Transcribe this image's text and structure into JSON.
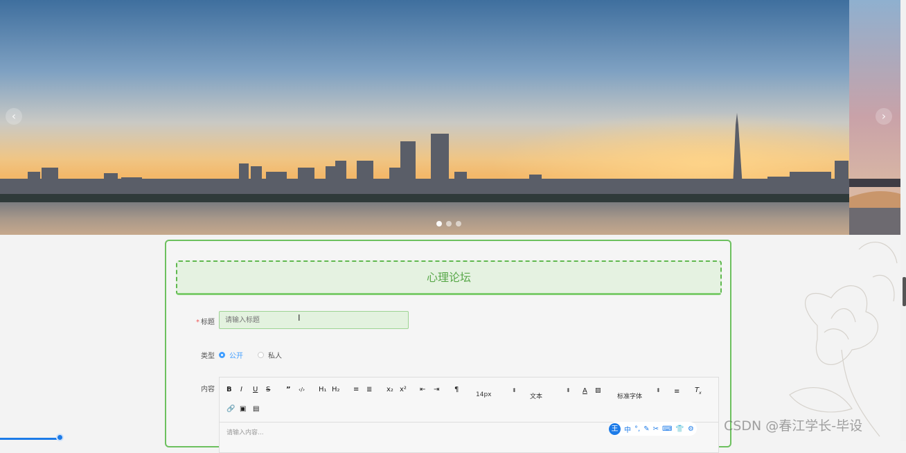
{
  "banner": {
    "prev_label": "‹",
    "next_label": "›",
    "slide_count": 3,
    "active_slide": 1
  },
  "form": {
    "title": "心理论坛",
    "title_label": "标题",
    "required_mark": "*",
    "title_placeholder": "请输入标题",
    "type_label": "类型",
    "type_options": [
      "公开",
      "私人"
    ],
    "type_selected": "公开",
    "content_label": "内容",
    "content_placeholder": "请输入内容..."
  },
  "editor_toolbar": {
    "row1": [
      "B",
      "I",
      "U",
      "S",
      "”",
      "‹/›",
      "H₁",
      "H₂",
      "≡",
      "≣",
      "x₂",
      "x²",
      "⇤",
      "⇥",
      "¶"
    ],
    "font_size": "14px",
    "header_type": "文本",
    "font_family": "标准字体",
    "row2": [
      "link",
      "image",
      "video"
    ]
  },
  "ime_toolbar": {
    "logo": "王",
    "items": [
      "中",
      "°,",
      "✎",
      "✂",
      "⌨",
      "👕",
      "⚙"
    ]
  },
  "watermark": "CSDN @春江学长-毕设",
  "colors": {
    "accent_green": "#6cc05e",
    "radio_blue": "#409eff",
    "ime_blue": "#1c7be8"
  }
}
